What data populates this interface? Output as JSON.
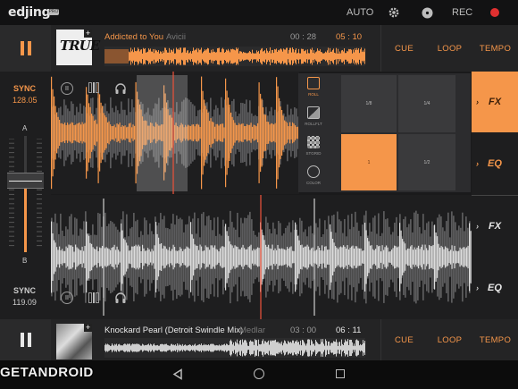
{
  "app": {
    "logo": "edjing",
    "logo_badge": "PRO"
  },
  "topbar": {
    "auto_label": "AUTO",
    "rec_label": "REC",
    "rec_color": "#e03030"
  },
  "deck_a": {
    "title": "Addicted to You",
    "artist": "Avicii",
    "elapsed": "00 : 28",
    "remaining": "05 : 10",
    "cover_text": "TRUE",
    "sync_label": "SYNC",
    "bpm": "128.05",
    "deck_letter": "A",
    "buttons": {
      "cue": "CUE",
      "loop": "LOOP",
      "tempo": "TEMPO"
    }
  },
  "deck_b": {
    "title": "Knockard Pearl (Detroit Swindle Mix)",
    "artist": "Medlar",
    "elapsed": "03 : 00",
    "remaining": "06 : 11",
    "sync_label": "SYNC",
    "bpm": "119.09",
    "deck_letter": "B",
    "buttons": {
      "cue": "CUE",
      "loop": "LOOP",
      "tempo": "TEMPO"
    }
  },
  "fx_panel": {
    "modes": [
      {
        "label": "ROLL",
        "active": true
      },
      {
        "label": "ROLLFLT",
        "active": false
      },
      {
        "label": "STGRID",
        "active": false
      },
      {
        "label": "COLOR",
        "active": false
      }
    ],
    "pads": [
      {
        "label": "1/8",
        "active": false
      },
      {
        "label": "1/4",
        "active": false
      },
      {
        "label": "1",
        "active": true
      },
      {
        "label": "1/2",
        "active": false
      }
    ]
  },
  "side_tabs": {
    "fx_a": "FX",
    "eq_a": "EQ",
    "fx_b": "FX",
    "eq_b": "EQ"
  },
  "colors": {
    "accent": "#f5964a",
    "background": "#1a1a1b"
  },
  "watermark": "GETANDROID"
}
